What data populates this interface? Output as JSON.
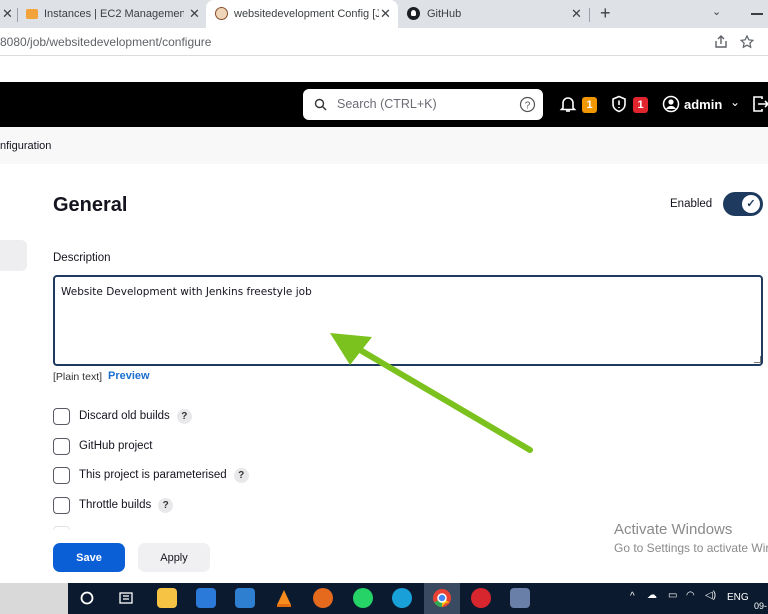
{
  "browser": {
    "tabs": [
      {
        "label": "Instances | EC2 Management Co"
      },
      {
        "label": "websitedevelopment Config [Jen"
      },
      {
        "label": "GitHub"
      }
    ],
    "new_tab": "+",
    "url": "8080/job/websitedevelopment/configure"
  },
  "header": {
    "search_placeholder": "Search (CTRL+K)",
    "notifications_count": "1",
    "security_count": "1",
    "user_name": "admin",
    "colors": {
      "notification_badge": "#f29700",
      "security_badge": "#e0252f"
    }
  },
  "breadcrumb": {
    "current": "nfiguration"
  },
  "general": {
    "title": "General",
    "enabled_label": "Enabled",
    "description_label": "Description",
    "description_value": "Website Development with Jenkins freestyle job",
    "plain_text": "[Plain text]",
    "preview_link": "Preview",
    "options": [
      {
        "label": "Discard old builds",
        "help": "?"
      },
      {
        "label": "GitHub project"
      },
      {
        "label": "This project is parameterised",
        "help": "?"
      },
      {
        "label": "Throttle builds",
        "help": "?"
      }
    ]
  },
  "actions": {
    "save": "Save",
    "apply": "Apply"
  },
  "watermark": {
    "line1": "Activate Windows",
    "line2": "Go to Settings to activate Wir"
  },
  "taskbar": {
    "lang": "ENG",
    "date_fragment": "09-"
  },
  "annotation": {
    "arrow_color": "#7cc21f"
  }
}
